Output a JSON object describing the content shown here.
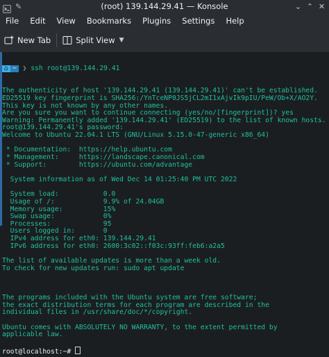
{
  "window": {
    "title": "(root) 139.144.29.41 — Konsole"
  },
  "menu": [
    "File",
    "Edit",
    "View",
    "Bookmarks",
    "Plugins",
    "Settings",
    "Help"
  ],
  "toolbar": {
    "new_tab": "New Tab",
    "split_view": "Split View"
  },
  "terminal": {
    "prompt_segment_a": "⌂",
    "prompt_segment_b": "~",
    "command": "ssh root@139.144.29.41",
    "lines": [
      "The authenticity of host '139.144.29.41 (139.144.29.41)' can't be established.",
      "ED25519 key fingerprint is SHA256:/YnTceNP0JS5jCL2mI1xAjvIk9pIU/PeW/Ob+X/AO2Y.",
      "This key is not known by any other names.",
      "Are you sure you want to continue connecting (yes/no/[fingerprint])? yes",
      "Warning: Permanently added '139.144.29.41' (ED25519) to the list of known hosts.",
      "root@139.144.29.41's password:",
      "Welcome to Ubuntu 22.04.1 LTS (GNU/Linux 5.15.0-47-generic x86_64)",
      "",
      " * Documentation:  https://help.ubuntu.com",
      " * Management:     https://landscape.canonical.com",
      " * Support:        https://ubuntu.com/advantage",
      "",
      "  System information as of Wed Dec 14 01:25:40 PM UTC 2022",
      "",
      "  System load:           0.0",
      "  Usage of /:            9.9% of 24.04GB",
      "  Memory usage:          15%",
      "  Swap usage:            0%",
      "  Processes:             95",
      "  Users logged in:       0",
      "  IPv4 address for eth0: 139.144.29.41",
      "  IPv6 address for eth0: 2600:3c02::f03c:93ff:feb6:a2a5",
      "",
      "The list of available updates is more than a week old.",
      "To check for new updates run: sudo apt update",
      "",
      "",
      "",
      "The programs included with the Ubuntu system are free software;",
      "the exact distribution terms for each program are described in the",
      "individual files in /usr/share/doc/*/copyright.",
      "",
      "Ubuntu comes with ABSOLUTELY NO WARRANTY, to the extent permitted by",
      "applicable law.",
      ""
    ],
    "final_prompt": "root@localhost:~# "
  }
}
